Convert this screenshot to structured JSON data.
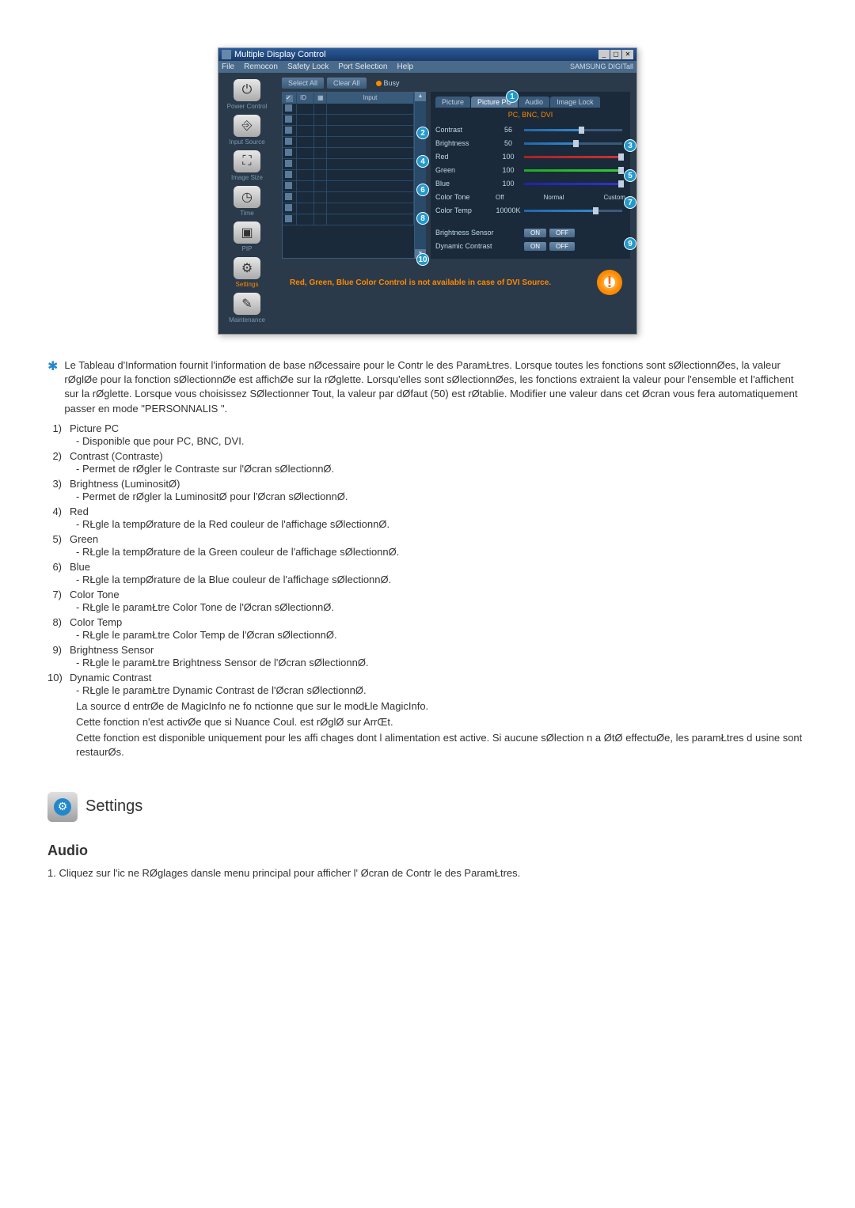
{
  "window": {
    "title": "Multiple Display Control",
    "menu": [
      "File",
      "Remocon",
      "Safety Lock",
      "Port Selection",
      "Help"
    ],
    "brand": "SAMSUNG DIGITall"
  },
  "sidebar": {
    "items": [
      {
        "label": "Power Control",
        "icon": "⏻"
      },
      {
        "label": "Input Source",
        "icon": "⎆"
      },
      {
        "label": "Image Size",
        "icon": "⛶"
      },
      {
        "label": "Time",
        "icon": "◷"
      },
      {
        "label": "PIP",
        "icon": "▣"
      },
      {
        "label": "Settings",
        "icon": "⚙",
        "active": true
      },
      {
        "label": "Maintenance",
        "icon": "✎"
      }
    ]
  },
  "toolbar": {
    "select_all": "Select All",
    "clear_all": "Clear All",
    "busy": "Busy"
  },
  "grid": {
    "headers": {
      "id": "ID",
      "input": "Input"
    }
  },
  "tabs": [
    "Picture",
    "Picture PC",
    "Audio",
    "Image Lock"
  ],
  "source_label": "PC, BNC, DVI",
  "controls": {
    "contrast": {
      "label": "Contrast",
      "value": "56"
    },
    "brightness": {
      "label": "Brightness",
      "value": "50"
    },
    "red": {
      "label": "Red",
      "value": "100"
    },
    "green": {
      "label": "Green",
      "value": "100"
    },
    "blue": {
      "label": "Blue",
      "value": "100"
    },
    "color_tone": {
      "label": "Color Tone",
      "opts": [
        "Off",
        "Normal",
        "Custom"
      ]
    },
    "color_temp": {
      "label": "Color Temp",
      "value": "10000K"
    },
    "brightness_sensor": {
      "label": "Brightness Sensor",
      "on": "ON",
      "off": "OFF"
    },
    "dynamic_contrast": {
      "label": "Dynamic Contrast",
      "on": "ON",
      "off": "OFF"
    }
  },
  "callouts": [
    "1",
    "2",
    "3",
    "4",
    "5",
    "6",
    "7",
    "8",
    "9",
    "10"
  ],
  "infobar": "Red, Green, Blue Color Control is not available in case of DVI Source.",
  "doc": {
    "star_text": "Le Tableau d'Information fournit l'information de base nØcessaire pour le Contr le des ParamŁtres. Lorsque toutes les fonctions sont sØlectionnØes, la valeur rØglØe pour la fonction sØlectionnØe est affichØe sur la rØglette. Lorsqu'elles sont sØlectionnØes, les fonctions extraient la valeur pour l'ensemble et l'affichent sur la rØglette. Lorsque vous choisissez SØlectionner Tout, la valeur par dØfaut (50) est rØtablie. Modifier une valeur dans cet Øcran vous fera automatiquement passer en mode \"PERSONNALIS \".",
    "items": [
      {
        "n": "1)",
        "t": "Picture PC",
        "d": "- Disponible que pour PC, BNC, DVI."
      },
      {
        "n": "2)",
        "t": "Contrast (Contraste)",
        "d": "- Permet de rØgler le Contraste sur l'Øcran sØlectionnØ."
      },
      {
        "n": "3)",
        "t": "Brightness (LuminositØ)",
        "d": "- Permet de rØgler la LuminositØ pour l'Øcran sØlectionnØ."
      },
      {
        "n": "4)",
        "t": "Red",
        "d": "- RŁgle la tempØrature de la Red couleur de l'affichage sØlectionnØ."
      },
      {
        "n": "5)",
        "t": "Green",
        "d": "- RŁgle la tempØrature de la Green couleur de l'affichage sØlectionnØ."
      },
      {
        "n": "6)",
        "t": "Blue",
        "d": "- RŁgle la tempØrature de la Blue couleur de l'affichage sØlectionnØ."
      },
      {
        "n": "7)",
        "t": "Color Tone",
        "d": "- RŁgle le paramŁtre Color Tone de l'Øcran sØlectionnØ."
      },
      {
        "n": "8)",
        "t": "Color Temp",
        "d": "- RŁgle le paramŁtre Color Temp de l'Øcran sØlectionnØ."
      },
      {
        "n": "9)",
        "t": "Brightness Sensor",
        "d": "- RŁgle le paramŁtre Brightness Sensor de l'Øcran sØlectionnØ."
      },
      {
        "n": "10)",
        "t": "Dynamic Contrast",
        "d": "- RŁgle le paramŁtre Dynamic Contrast de l'Øcran sØlectionnØ."
      }
    ],
    "notes": [
      "La source d entrØe de MagicInfo ne fo      nctionne que sur le modŁle MagicInfo.",
      "Cette fonction n'est activØe que si Nuance Coul. est rØglØ sur ArrŒt.",
      "Cette fonction est disponible uniquement pour les affi       chages dont l alimentation est active. Si aucune sØlection n a ØtØ effectuØe, les paramŁtres d usine sont restaurØs."
    ]
  },
  "settings_heading": "Settings",
  "audio": {
    "title": "Audio",
    "line1": "1.  Cliquez sur l'ic ne RØglages dansle menu principal pour afficher l' Øcran de Contr le des ParamŁtres."
  }
}
